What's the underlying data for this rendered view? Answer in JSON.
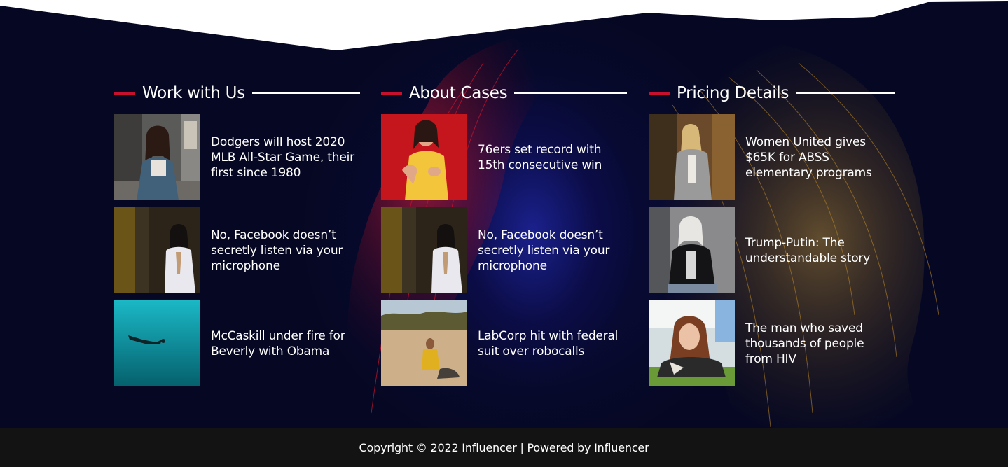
{
  "columns": [
    {
      "title": "Work with Us",
      "posts": [
        {
          "title": "Dodgers will host 2020 MLB All-Star Game, their first since 1980",
          "image": "woman-street-photo"
        },
        {
          "title": "No, Facebook doesn’t secretly listen via your microphone",
          "image": "woman-white-dress-photo"
        },
        {
          "title": "McCaskill under fire for Beverly with Obama",
          "image": "underwater-swimmer-photo"
        }
      ]
    },
    {
      "title": "About Cases",
      "posts": [
        {
          "title": "76ers set record with 15th consecutive win",
          "image": "woman-red-background-photo"
        },
        {
          "title": "No, Facebook doesn’t secretly listen via your microphone",
          "image": "woman-white-dress-photo"
        },
        {
          "title": "LabCorp hit with federal suit over robocalls",
          "image": "woman-desert-photo"
        }
      ]
    },
    {
      "title": "Pricing Details",
      "posts": [
        {
          "title": "Women United gives $65K for ABSS elementary programs",
          "image": "woman-autumn-forest-photo"
        },
        {
          "title": "Trump-Putin: The understandable story",
          "image": "woman-leather-jacket-photo"
        },
        {
          "title": "The man who saved thousands of people from HIV",
          "image": "woman-lying-grass-photo"
        }
      ]
    }
  ],
  "footer": {
    "copyright": "Copyright © 2022 Influencer | Powered by Influencer"
  },
  "colors": {
    "accent_red": "#c8102e",
    "background": "#060823",
    "footer_bg": "#131313"
  }
}
